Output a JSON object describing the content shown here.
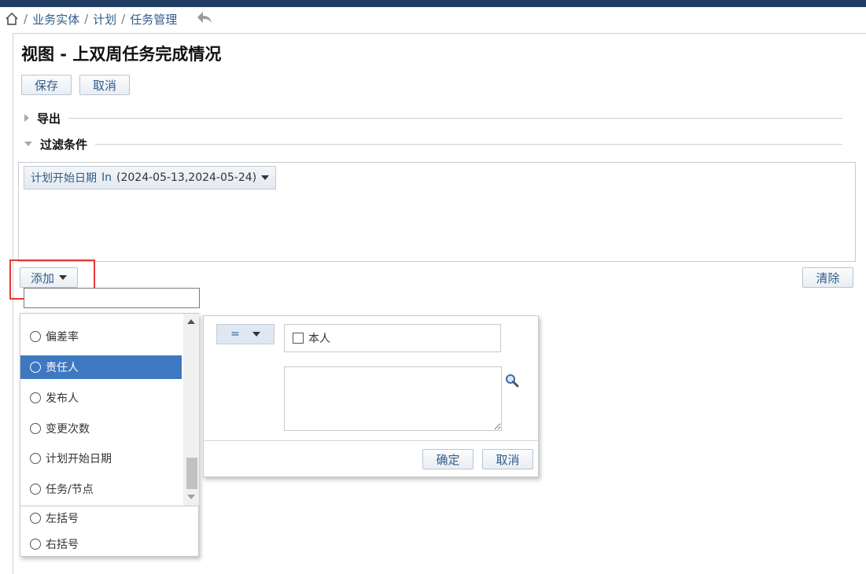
{
  "breadcrumb": {
    "separator": "/",
    "items": [
      "业务实体",
      "计划",
      "任务管理"
    ]
  },
  "page": {
    "title": "视图 - 上双周任务完成情况"
  },
  "toolbar": {
    "save_label": "保存",
    "cancel_label": "取消"
  },
  "sections": {
    "export_label": "导出",
    "filter_label": "过滤条件"
  },
  "filter": {
    "chip": {
      "field": "计划开始日期",
      "operator": "In",
      "value": "(2024-05-13,2024-05-24)"
    },
    "add_label": "添加",
    "clear_label": "清除"
  },
  "field_search": {
    "value": "",
    "placeholder": ""
  },
  "field_list": {
    "items": [
      "偏差率",
      "责任人",
      "发布人",
      "变更次数",
      "计划开始日期",
      "任务/节点"
    ],
    "selected": "责任人",
    "extra_items": [
      "左括号",
      "右括号"
    ]
  },
  "condition": {
    "operator": "=",
    "self_label": "本人",
    "ok_label": "确定",
    "cancel_label": "取消"
  },
  "colors": {
    "top_bar": "#1f3d63",
    "link": "#2f5d8a",
    "selected": "#3d78c1",
    "highlight": "#e53935"
  }
}
